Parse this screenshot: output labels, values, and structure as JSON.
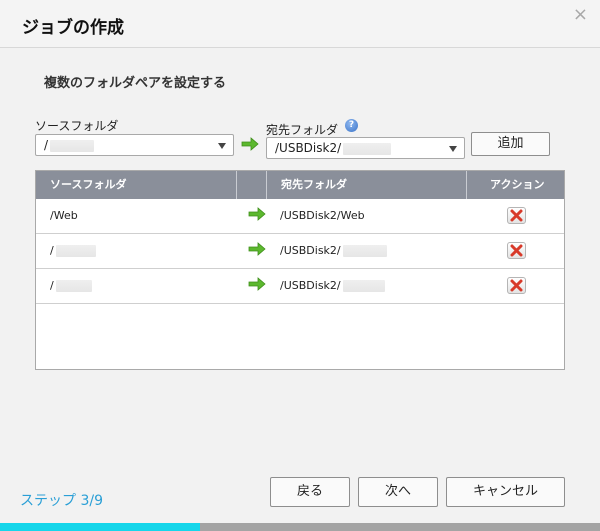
{
  "dialog": {
    "title": "ジョブの作成",
    "close_label": "×"
  },
  "section_title": "複数のフォルダペアを設定する",
  "source": {
    "label": "ソースフォルダ",
    "value": "/"
  },
  "destination": {
    "label": "宛先フォルダ",
    "value": "/USBDisk2/"
  },
  "help_icon_glyph": "?",
  "add_button_label": "追加",
  "table": {
    "columns": [
      "ソースフォルダ",
      "",
      "宛先フォルダ",
      "アクション"
    ],
    "rows": [
      {
        "source": "/Web",
        "destination": "/USBDisk2/Web"
      },
      {
        "source": "/",
        "destination": "/USBDisk2/"
      },
      {
        "source": "/",
        "destination": "/USBDisk2/"
      }
    ]
  },
  "footer": {
    "step_text": "ステップ 3/9",
    "back_label": "戻る",
    "next_label": "次へ",
    "cancel_label": "キャンセル"
  },
  "progress": {
    "value": 0.333
  },
  "colors": {
    "accent": "#2a9fd6",
    "progress_fill": "#16d6ea",
    "header_bg": "#8a8f9a",
    "arrow": "#5cb82e",
    "delete": "#d83a2a"
  },
  "icons": {
    "arrow": "right-arrow-icon",
    "delete": "delete-x-icon",
    "help": "help-question-icon",
    "close": "close-icon",
    "caret": "chevron-down-icon"
  }
}
